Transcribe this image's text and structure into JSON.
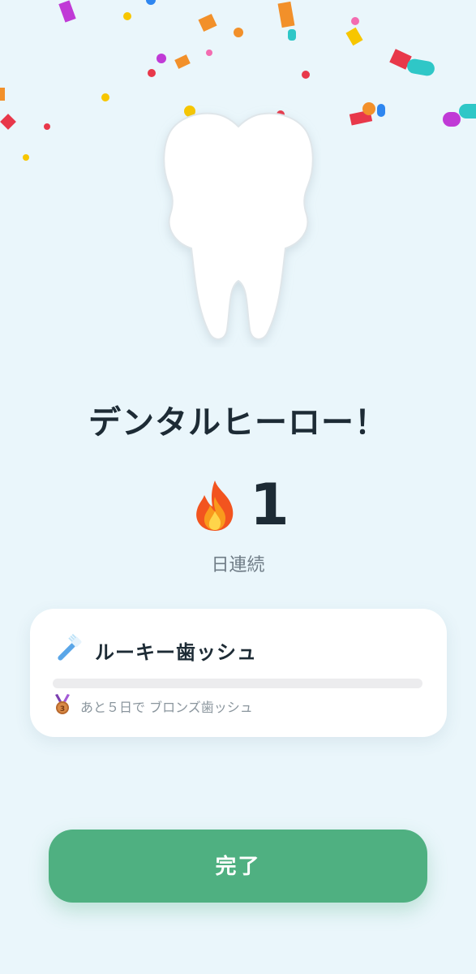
{
  "celebration": {
    "title": "デンタルヒーロー！"
  },
  "streak": {
    "count": "1",
    "unit_label": "日連続",
    "icon": "fire-icon"
  },
  "badge_card": {
    "icon": "toothbrush-icon",
    "title": "ルーキー歯ッシュ",
    "progress": 0,
    "next_icon": "bronze-medal-icon",
    "next_text": "あと５日で ブロンズ歯ッシュ"
  },
  "actions": {
    "done_label": "完了"
  },
  "colors": {
    "background": "#eaf6fb",
    "primary": "#4fb081",
    "text_dark": "#1d2b35",
    "text_muted": "#8a959d"
  }
}
